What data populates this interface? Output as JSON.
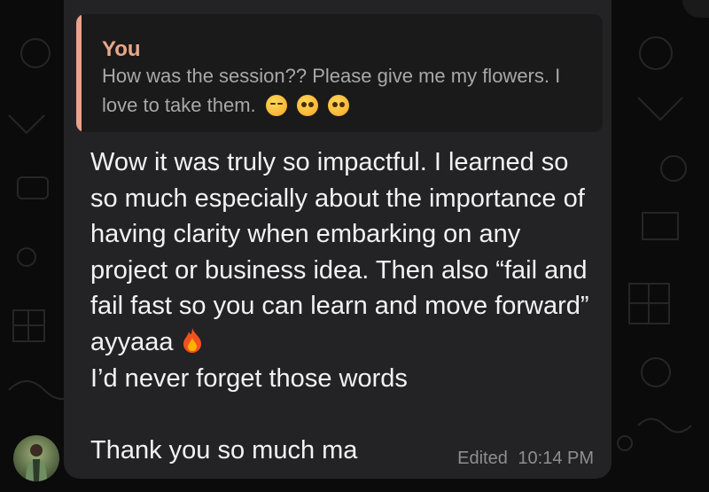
{
  "wallpaper": {
    "pattern": "doodle-icons"
  },
  "reply_quote": {
    "author": "You",
    "text": "How was the session?? Please give me my flowers. I love to take them.",
    "emojis": [
      "weary-face-emoji",
      "pleading-face-emoji",
      "pleading-face-emoji"
    ]
  },
  "message": {
    "text_main": "Wow it was truly so impactful. I learned so so much especially about the importance of having clarity when embarking on any project or business idea. Then also “fail and fail fast so you can learn and move forward” ayyaaa",
    "text_after_fire": "I’d never forget those words\n\nThank you so much ma",
    "edited_label": "Edited",
    "time": "10:14 PM"
  },
  "colors": {
    "bubble": "#232325",
    "quote_accent": "#e7a48b",
    "text": "#f2f2f2",
    "meta": "#8e8e8e"
  }
}
